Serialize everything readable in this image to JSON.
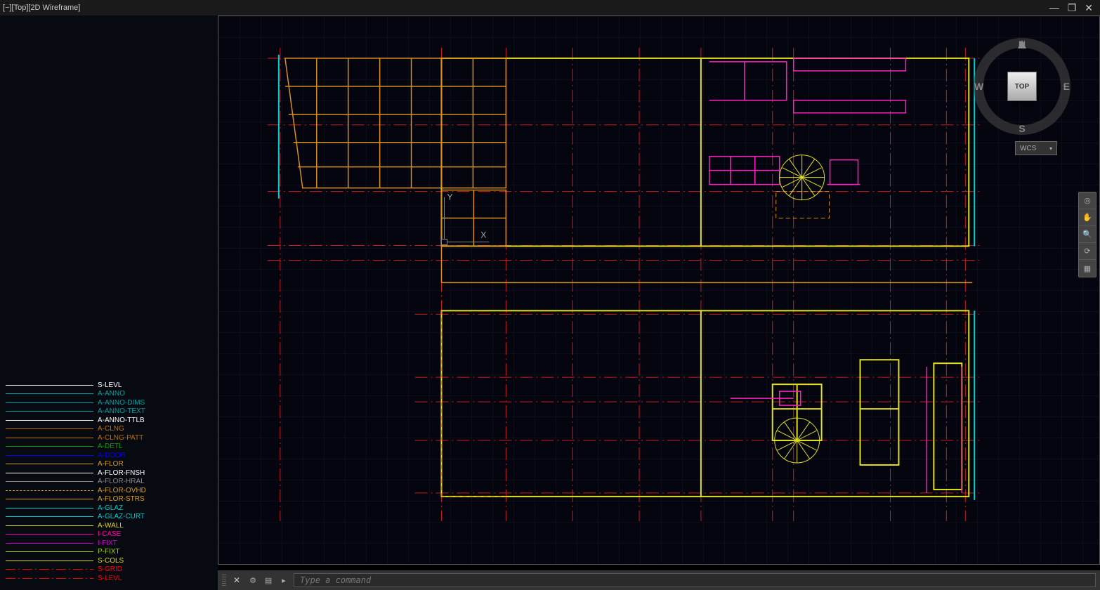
{
  "titlebar": {
    "label": "[−][Top][2D Wireframe]"
  },
  "viewcube": {
    "face": "TOP",
    "n": "N",
    "s": "S",
    "e": "E",
    "w": "W",
    "wcs": "WCS"
  },
  "command": {
    "placeholder": "Type a command"
  },
  "ucs": {
    "x": "X",
    "y": "Y"
  },
  "legend": [
    {
      "label": "S-LEVL",
      "color": "#ffffff",
      "style": "solid"
    },
    {
      "label": "A-ANNO",
      "color": "#00a0a0",
      "style": "solid"
    },
    {
      "label": "A-ANNO-DIMS",
      "color": "#00a0a0",
      "style": "solid"
    },
    {
      "label": "A-ANNO-TEXT",
      "color": "#00a0a0",
      "style": "solid"
    },
    {
      "label": "A-ANNO-TTLB",
      "color": "#ffffff",
      "style": "solid"
    },
    {
      "label": "A-CLNG",
      "color": "#c07000",
      "style": "solid"
    },
    {
      "label": "A-CLNG-PATT",
      "color": "#c07000",
      "style": "solid"
    },
    {
      "label": "A-DETL",
      "color": "#00a000",
      "style": "solid"
    },
    {
      "label": "A-DOOR",
      "color": "#0000ff",
      "style": "solid"
    },
    {
      "label": "A-FLOR",
      "color": "#d8a020",
      "style": "solid"
    },
    {
      "label": "A-FLOR-FNSH",
      "color": "#ffffff",
      "style": "solid"
    },
    {
      "label": "A-FLOR-HRAL",
      "color": "#888888",
      "style": "solid"
    },
    {
      "label": "A-FLOR-OVHD",
      "color": "#d8a020",
      "style": "dashed"
    },
    {
      "label": "A-FLOR-STRS",
      "color": "#d8a020",
      "style": "solid"
    },
    {
      "label": "A-GLAZ",
      "color": "#00cccc",
      "style": "solid"
    },
    {
      "label": "A-GLAZ-CURT",
      "color": "#00cccc",
      "style": "solid"
    },
    {
      "label": "A-WALL",
      "color": "#d8d820",
      "style": "solid"
    },
    {
      "label": "I-CASE",
      "color": "#ff00aa",
      "style": "solid"
    },
    {
      "label": "I-FIXT",
      "color": "#cc00cc",
      "style": "solid"
    },
    {
      "label": "P-FIXT",
      "color": "#a0d000",
      "style": "solid"
    },
    {
      "label": "S-COLS",
      "color": "#d8d820",
      "style": "solid"
    },
    {
      "label": "S-GRID",
      "color": "#ff0000",
      "style": "dashdot"
    },
    {
      "label": "S-LEVL",
      "color": "#ff0000",
      "style": "dashdot"
    }
  ]
}
